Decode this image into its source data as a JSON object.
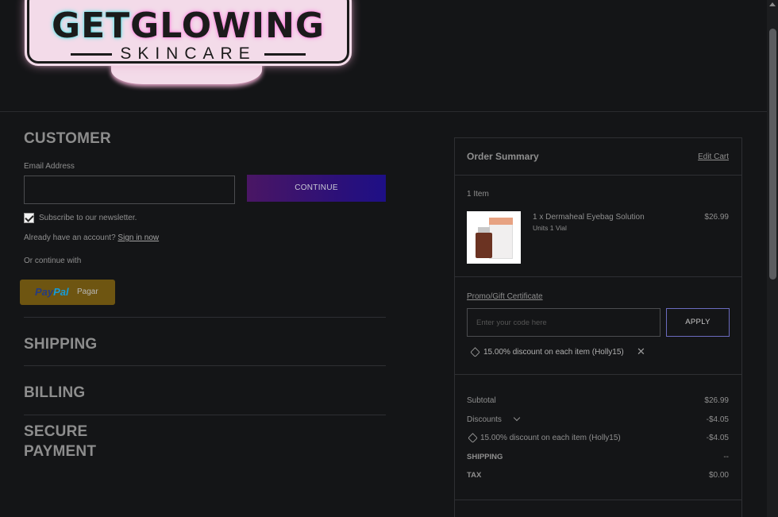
{
  "logo": {
    "title_part1": "GET",
    "title_part2": "GLOWING",
    "subtitle": "SKINCARE"
  },
  "checkout": {
    "customer": {
      "title": "CUSTOMER",
      "email_label": "Email Address",
      "email_value": "",
      "continue_label": "CONTINUE",
      "subscribe_label": "Subscribe to our newsletter.",
      "subscribe_checked": true,
      "account_prompt": "Already have an account?",
      "sign_in_label": "Sign in now",
      "or_continue": "Or continue with",
      "paypal_pay": "Pay",
      "paypal_pal": "Pal",
      "paypal_pagar": "Pagar"
    },
    "steps": [
      {
        "title": "SHIPPING"
      },
      {
        "title": "BILLING"
      },
      {
        "title_line1": "SECURE",
        "title_line2": "PAYMENT"
      }
    ]
  },
  "summary": {
    "title": "Order Summary",
    "edit_cart": "Edit Cart",
    "item_count": "1 Item",
    "item": {
      "name": "1 x Dermaheal Eyebag Solution",
      "variant": "Units 1 Vial",
      "price": "$26.99"
    },
    "promo_label": "Promo/Gift Certificate",
    "promo_placeholder": "Enter your code here",
    "apply_label": "APPLY",
    "applied_coupon": "15.00% discount on each item (Holly15)",
    "subtotal_label": "Subtotal",
    "subtotal_value": "$26.99",
    "discounts_label": "Discounts",
    "discounts_value": "-$4.05",
    "coupon_line_label": "15.00% discount on each item (Holly15)",
    "coupon_line_value": "-$4.05",
    "shipping_label": "SHIPPING",
    "shipping_value": "--",
    "tax_label": "TAX",
    "tax_value": "$0.00"
  },
  "colors": {
    "background": "#141517",
    "continue_gradient_start": "#4a1664",
    "continue_gradient_end": "#1e0f86",
    "paypal_button": "#6e5511",
    "apply_border": "#6b6bbf"
  }
}
